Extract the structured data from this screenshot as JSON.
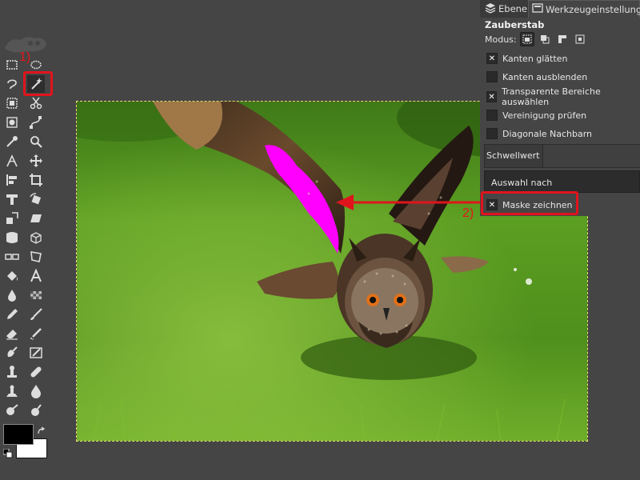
{
  "dock": {
    "tabs": [
      {
        "label": "Ebenen",
        "icon": "layers-icon"
      },
      {
        "label": "Werkzeugeinstellungen",
        "icon": "tool-options-icon"
      }
    ],
    "tool_title": "Zauberstab",
    "mode_label": "Modus:",
    "options": [
      {
        "label": "Kanten glätten",
        "checked": true
      },
      {
        "label": "Kanten ausblenden",
        "checked": false
      },
      {
        "label": "Transparente Bereiche auswählen",
        "checked": true
      },
      {
        "label": "Vereinigung prüfen",
        "checked": false
      },
      {
        "label": "Diagonale Nachbarn",
        "checked": false
      }
    ],
    "threshold_label": "Schwellwert",
    "select_by_label": "Auswahl nach",
    "draw_mask_label": "Maske zeichnen",
    "draw_mask_checked": true
  },
  "annotations": {
    "step1": "1)",
    "step2": "2)",
    "color": "#e0141c"
  },
  "colors": {
    "highlight": "#ff00ff",
    "background": "#454545",
    "selection_border": "#e8e26a"
  }
}
